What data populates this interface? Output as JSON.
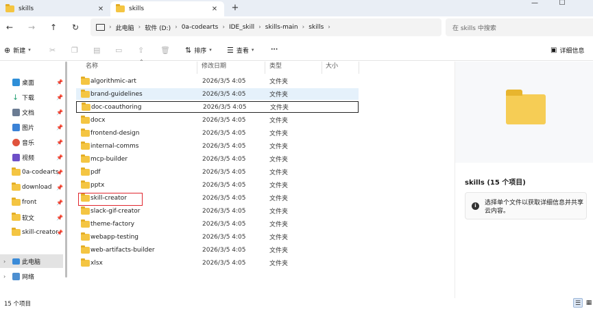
{
  "tabs": [
    {
      "label": "skills",
      "active": false
    },
    {
      "label": "skills",
      "active": true
    }
  ],
  "window_controls": {
    "minimize": "—",
    "maximize": "☐"
  },
  "breadcrumb": [
    "此电脑",
    "软件 (D:)",
    "0a-codearts",
    "IDE_skill",
    "skills-main",
    "skills"
  ],
  "search": {
    "placeholder": "在 skills 中搜索"
  },
  "toolbar": {
    "new_label": "新建",
    "sort_label": "排序",
    "view_label": "查看",
    "more_label": "···",
    "details_label": "详细信息"
  },
  "sidebar": {
    "quick_access": [
      {
        "label": "桌面",
        "color": "#2f8fd8"
      },
      {
        "label": "下载",
        "color": "#1f9e6f"
      },
      {
        "label": "文档",
        "color": "#6b7c93"
      },
      {
        "label": "图片",
        "color": "#3b82d6"
      },
      {
        "label": "音乐",
        "color": "#e0533d"
      },
      {
        "label": "视频",
        "color": "#6d4fc7"
      },
      {
        "label": "0a-codearts",
        "color": "#f4c542"
      },
      {
        "label": "download",
        "color": "#f4c542"
      },
      {
        "label": "front",
        "color": "#f4c542"
      },
      {
        "label": "软文",
        "color": "#f4c542"
      },
      {
        "label": "skill-creator",
        "color": "#f4c542"
      }
    ],
    "this_pc": "此电脑",
    "network": "网络"
  },
  "columns": {
    "name": "名称",
    "modified": "修改日期",
    "type": "类型",
    "size": "大小"
  },
  "files": [
    {
      "name": "algorithmic-art",
      "date": "2026/3/5 4:05",
      "type": "文件夹"
    },
    {
      "name": "brand-guidelines",
      "date": "2026/3/5 4:05",
      "type": "文件夹"
    },
    {
      "name": "doc-coauthoring",
      "date": "2026/3/5 4:05",
      "type": "文件夹"
    },
    {
      "name": "docx",
      "date": "2026/3/5 4:05",
      "type": "文件夹"
    },
    {
      "name": "frontend-design",
      "date": "2026/3/5 4:05",
      "type": "文件夹"
    },
    {
      "name": "internal-comms",
      "date": "2026/3/5 4:05",
      "type": "文件夹"
    },
    {
      "name": "mcp-builder",
      "date": "2026/3/5 4:05",
      "type": "文件夹"
    },
    {
      "name": "pdf",
      "date": "2026/3/5 4:05",
      "type": "文件夹"
    },
    {
      "name": "pptx",
      "date": "2026/3/5 4:05",
      "type": "文件夹"
    },
    {
      "name": "skill-creator",
      "date": "2026/3/5 4:05",
      "type": "文件夹"
    },
    {
      "name": "slack-gif-creator",
      "date": "2026/3/5 4:05",
      "type": "文件夹"
    },
    {
      "name": "theme-factory",
      "date": "2026/3/5 4:05",
      "type": "文件夹"
    },
    {
      "name": "webapp-testing",
      "date": "2026/3/5 4:05",
      "type": "文件夹"
    },
    {
      "name": "web-artifacts-builder",
      "date": "2026/3/5 4:05",
      "type": "文件夹"
    },
    {
      "name": "xlsx",
      "date": "2026/3/5 4:05",
      "type": "文件夹"
    }
  ],
  "details_pane": {
    "title": "skills (15 个项目)",
    "info": "选择单个文件以获取详细信息并共享云内容。"
  },
  "status": {
    "count": "15 个项目"
  },
  "colors": {
    "highlight": "#e0242c",
    "folder": "#f4c542"
  }
}
